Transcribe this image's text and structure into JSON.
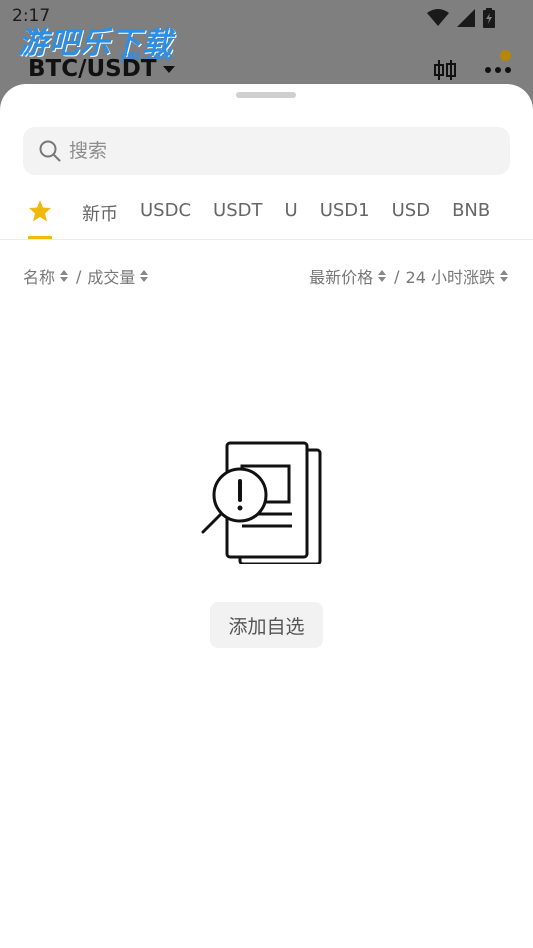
{
  "status_bar": {
    "time": "2:17"
  },
  "watermark": {
    "text": "游吧乐下载",
    "sub": "yBL.com"
  },
  "header": {
    "pair": "BTC/USDT"
  },
  "search": {
    "placeholder": "搜索"
  },
  "tabs": [
    {
      "label": "",
      "icon": "star-icon",
      "active": true
    },
    {
      "label": "新币"
    },
    {
      "label": "USDC"
    },
    {
      "label": "USDT"
    },
    {
      "label": "U"
    },
    {
      "label": "USD1"
    },
    {
      "label": "USD"
    },
    {
      "label": "BNB"
    }
  ],
  "sort": {
    "name": "名称",
    "volume": "成交量",
    "price": "最新价格",
    "change": "24 小时涨跌",
    "separator": "/"
  },
  "empty_state": {
    "button": "添加自选"
  },
  "colors": {
    "accent": "#f0b90b",
    "watermark": "#2b8fe6"
  }
}
